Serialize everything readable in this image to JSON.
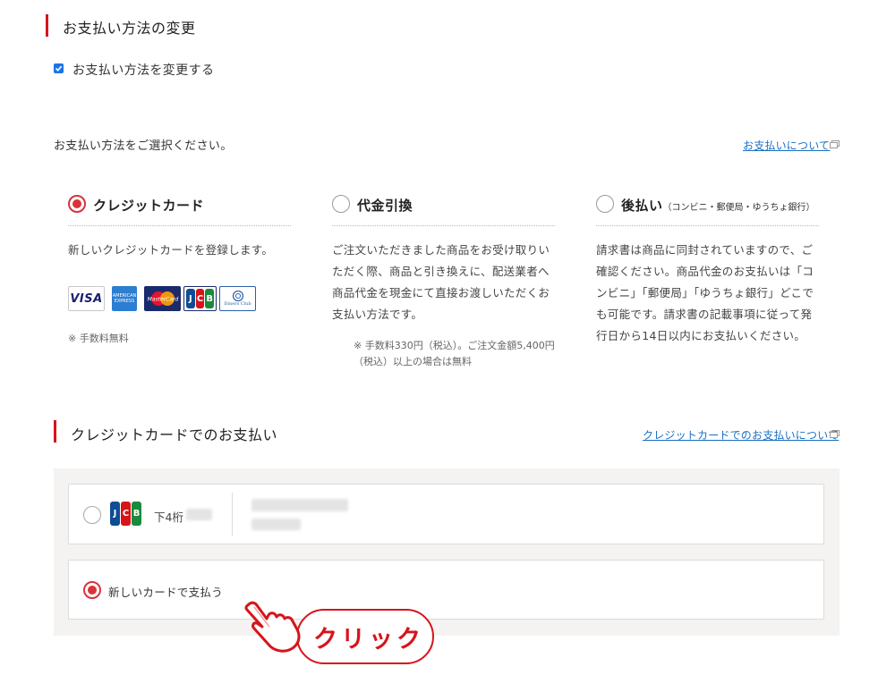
{
  "section1": {
    "title": "お支払い方法の変更"
  },
  "change_checkbox": {
    "label": "お支払い方法を変更する",
    "checked": true
  },
  "instruction": "お支払い方法をご選択ください。",
  "payment_help_link": "お支払いについて",
  "options": [
    {
      "title": "クレジットカード",
      "selected": true,
      "desc": "新しいクレジットカードを登録します。",
      "note": "※ 手数料無料",
      "logos": [
        "VISA",
        "AMERICAN EXPRESS",
        "MasterCard",
        "JCB",
        "Diners Club INTERNATIONAL"
      ]
    },
    {
      "title": "代金引換",
      "selected": false,
      "desc": "ご注文いただきました商品をお受け取りいただく際、商品と引き換えに、配送業者へ商品代金を現金にて直接お渡しいただくお支払い方法です。",
      "note": "※ 手数料330円（税込）。ご注文金額5,400円（税込）以上の場合は無料"
    },
    {
      "title": "後払い",
      "subtitle": "（コンビニ・郵便局・ゆうちょ銀行）",
      "selected": false,
      "desc": "請求書は商品に同封されていますので、ご確認ください。商品代金のお支払いは「コンビニ」「郵便局」「ゆうちょ銀行」どこでも可能です。請求書の記載事項に従って発行日から14日以内にお支払いください。"
    }
  ],
  "section2": {
    "title": "クレジットカードでのお支払い",
    "help_link": "クレジットカードでのお支払いについて"
  },
  "saved_card": {
    "brand": "JCB",
    "last4_label": "下4桁",
    "selected": false
  },
  "new_card": {
    "label": "新しいカードで支払う",
    "selected": true
  },
  "callout": {
    "text": "クリック"
  },
  "colors": {
    "accent": "#d7141a",
    "link": "#1a6fc2",
    "panel": "#f4f3f1"
  }
}
